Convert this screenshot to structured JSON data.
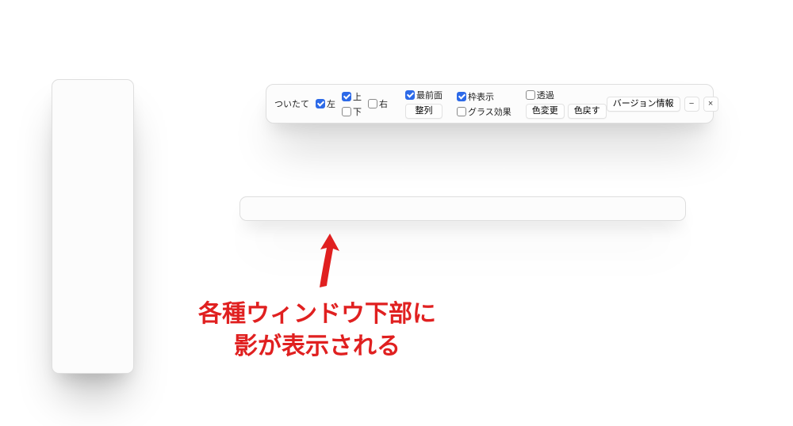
{
  "toolbar": {
    "title": "ついたて",
    "left": {
      "label": "左",
      "checked": true
    },
    "up": {
      "label": "上",
      "checked": true
    },
    "right": {
      "label": "右",
      "checked": false
    },
    "down": {
      "label": "下",
      "checked": false
    },
    "topmost": {
      "label": "最前面",
      "checked": true
    },
    "align_button": "整列",
    "show_frame": {
      "label": "枠表示",
      "checked": true
    },
    "glass": {
      "label": "グラス効果",
      "checked": false
    },
    "transparent": {
      "label": "透過",
      "checked": false
    },
    "change_color_button": "色変更",
    "reset_color_button": "色戻す",
    "version_button": "バージョン情報",
    "minimize_glyph": "−",
    "close_glyph": "×"
  },
  "annotation": {
    "line1": "各種ウィンドウ下部に",
    "line2": "影が表示される"
  }
}
